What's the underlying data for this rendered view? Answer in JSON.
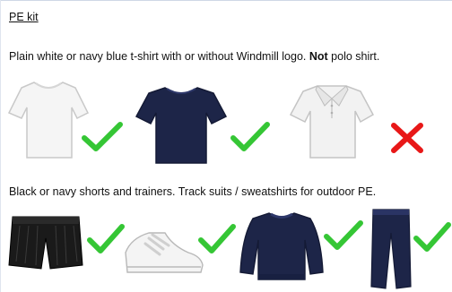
{
  "heading": "PE kit",
  "tshirt_rule": {
    "before": "Plain white or navy blue t-shirt with or without Windmill logo.  ",
    "emphasis": "Not",
    "after": " polo shirt."
  },
  "bottoms_rule": "Black or navy shorts and trainers.  Track suits / sweatshirts for outdoor PE.",
  "items": [
    {
      "id": "white-tshirt",
      "status": "allowed"
    },
    {
      "id": "navy-tshirt",
      "status": "allowed"
    },
    {
      "id": "white-polo-shirt",
      "status": "not-allowed"
    },
    {
      "id": "black-shorts",
      "status": "allowed"
    },
    {
      "id": "white-trainers",
      "status": "allowed"
    },
    {
      "id": "navy-sweatshirt",
      "status": "allowed"
    },
    {
      "id": "navy-tracksuit-bottoms",
      "status": "allowed"
    }
  ],
  "icons": {
    "allowed": "check-mark-icon",
    "not_allowed": "cross-mark-icon"
  },
  "colors": {
    "check": "#35c635",
    "cross": "#e81818",
    "navy": "#1d2548",
    "black": "#1a1a1a"
  }
}
